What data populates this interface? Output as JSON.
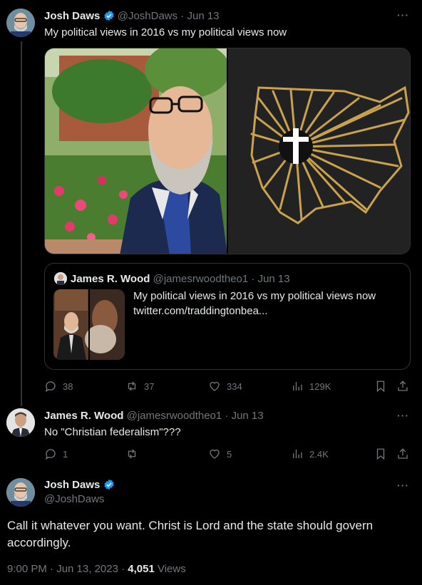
{
  "tweet1": {
    "author_name": "Josh Daws",
    "handle": "@JoshDaws",
    "date": "Jun 13",
    "text": "My political views in 2016 vs my political views now",
    "quote": {
      "author_name": "James R. Wood",
      "handle": "@jamesrwoodtheo1",
      "date": "Jun 13",
      "text": "My political views in 2016 vs my political views now",
      "link": "twitter.com/traddingtonbea..."
    },
    "actions": {
      "replies": "38",
      "retweets": "37",
      "likes": "334",
      "views": "129K"
    }
  },
  "tweet2": {
    "author_name": "James R. Wood",
    "handle": "@jamesrwoodtheo1",
    "date": "Jun 13",
    "text": "No \"Christian federalism\"???",
    "actions": {
      "replies": "1",
      "retweets": "",
      "likes": "5",
      "views": "2.4K"
    }
  },
  "main_tweet": {
    "author_name": "Josh Daws",
    "handle": "@JoshDaws",
    "text": "Call it whatever you want. Christ is Lord and the state should govern accordingly.",
    "timestamp": "9:00 PM · Jun 13, 2023 · ",
    "views_count": "4,051",
    "views_label": " Views"
  },
  "separator": " · ",
  "colors": {
    "verified": "#1d9bf0",
    "gold": "#c9a24b"
  }
}
